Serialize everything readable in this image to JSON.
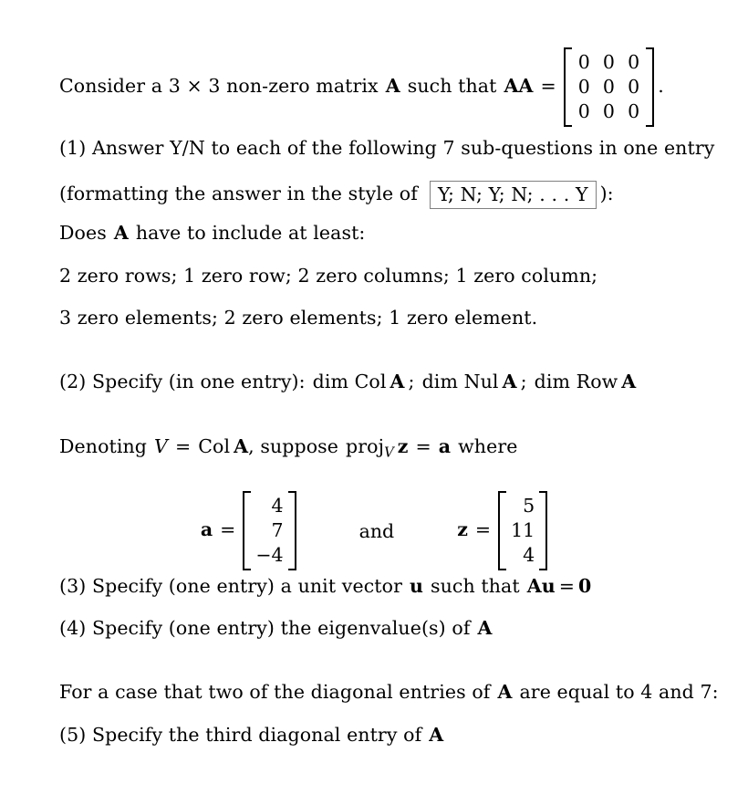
{
  "document": {
    "background_color": "#ffffff",
    "text_color": "#000000",
    "box_border_color": "#808080"
  },
  "intro": {
    "text_before": "Consider a 3 × 3 non-zero matrix",
    "matrix_symbol_A": "A",
    "text_middle": "such that",
    "product_label": "AA",
    "equals": "=",
    "zero_matrix": [
      [
        "0",
        "0",
        "0"
      ],
      [
        "0",
        "0",
        "0"
      ],
      [
        "0",
        "0",
        "0"
      ]
    ],
    "period": "."
  },
  "q1": {
    "line1": "(1) Answer Y/N to each of the following 7 sub-questions in one entry",
    "line2_prefix": "(formatting the answer in the style of",
    "example_answer": "Y; N; Y; N; . . . Y",
    "line2_suffix": "):",
    "prompt_prefix": "Does",
    "prompt_symbol": "A",
    "prompt_suffix": "have to include at least:",
    "subquestions_line1": "2 zero rows; 1 zero row; 2 zero columns; 1 zero column;",
    "subquestions_line2": "3 zero elements; 2 zero elements; 1 zero element."
  },
  "q2": {
    "prefix": "(2) Specify (in one entry):",
    "item1_op": "dim Col",
    "item1_sym": "A",
    "sep1": ";",
    "item2_op": "dim Nul",
    "item2_sym": "A",
    "sep2": ";",
    "item3_op": "dim Row",
    "item3_sym": "A"
  },
  "denoting": {
    "word_denoting": "Denoting",
    "v": "V",
    "equals": "=",
    "col": "Col",
    "a_sym": "A",
    "comma_suppose": ", suppose",
    "proj": "proj",
    "proj_sub": "V",
    "z_sym": "z",
    "equals2": "=",
    "a_vec_sym": "a",
    "word_where": "where"
  },
  "vectors": {
    "a_label": "a",
    "a_equals": "=",
    "a_values": [
      "4",
      "7",
      "−4"
    ],
    "conjunction": "and",
    "z_label": "z",
    "z_equals": "=",
    "z_values": [
      "5",
      "11",
      "4"
    ]
  },
  "q3": {
    "prefix": "(3) Specify (one entry) a unit vector",
    "u_sym": "u",
    "middle": "such that",
    "equation_A": "A",
    "equation_u": "u",
    "equation_eq": "=",
    "equation_zero": "0"
  },
  "q4": {
    "prefix": "(4) Specify (one entry) the eigenvalue(s) of",
    "sym": "A"
  },
  "case_note": {
    "prefix": "For a case that two of the diagonal entries of",
    "sym": "A",
    "suffix": "are equal to 4 and 7:"
  },
  "q5": {
    "prefix": "(5) Specify the third diagonal entry of",
    "sym": "A"
  }
}
